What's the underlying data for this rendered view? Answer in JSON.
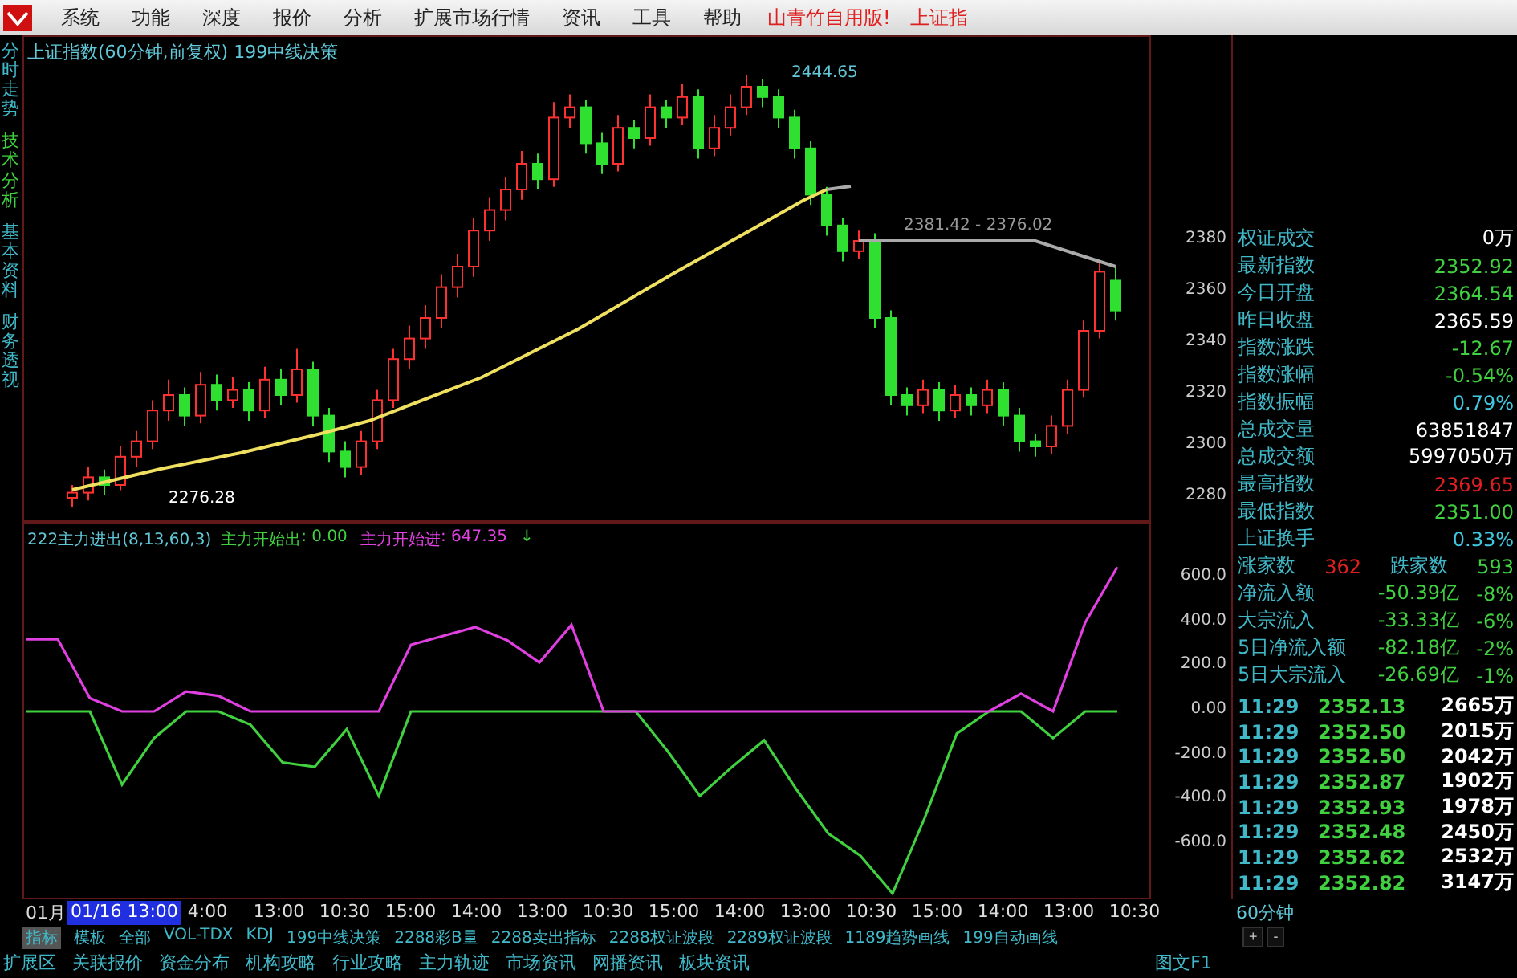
{
  "menu_bar": {
    "items": [
      "系统",
      "功能",
      "深度",
      "报价",
      "分析",
      "扩展市场行情",
      "资讯",
      "工具",
      "帮助"
    ],
    "notice": "山青竹自用版!",
    "notice_tail": "上证指"
  },
  "side_tabs": [
    {
      "label": "分时走势",
      "selected": false
    },
    {
      "label": "技术分析",
      "selected": true
    },
    {
      "label": "基本资料",
      "selected": false
    },
    {
      "label": "财务透视",
      "selected": false
    }
  ],
  "price_chart": {
    "title": "上证指数(60分钟,前复权) 199中线决策",
    "high_label": "2444.65",
    "low_label": "2276.28",
    "range_label": "2381.42 - 2376.02",
    "chart_data": {
      "type": "candlestick",
      "ylim": [
        2270.625,
        2460
      ],
      "yticks": [
        2380,
        2360,
        2340,
        2320,
        2300,
        2280
      ],
      "ohlc": [
        [
          2280,
          2285,
          2276.28,
          2282
        ],
        [
          2282,
          2292,
          2279,
          2288
        ],
        [
          2288,
          2291,
          2281,
          2285
        ],
        [
          2285,
          2300,
          2283,
          2296
        ],
        [
          2296,
          2306,
          2292,
          2302
        ],
        [
          2302,
          2318,
          2299,
          2314
        ],
        [
          2314,
          2326,
          2310,
          2320
        ],
        [
          2320,
          2323,
          2308,
          2312
        ],
        [
          2312,
          2329,
          2309,
          2324
        ],
        [
          2324,
          2328,
          2314,
          2318
        ],
        [
          2318,
          2327,
          2315,
          2322
        ],
        [
          2322,
          2325,
          2310,
          2314
        ],
        [
          2314,
          2331,
          2311,
          2326
        ],
        [
          2326,
          2330,
          2316,
          2320
        ],
        [
          2320,
          2338,
          2317,
          2330
        ],
        [
          2330,
          2333,
          2308,
          2312
        ],
        [
          2312,
          2315,
          2294,
          2298
        ],
        [
          2298,
          2302,
          2288,
          2292
        ],
        [
          2292,
          2306,
          2289,
          2302
        ],
        [
          2302,
          2322,
          2299,
          2318
        ],
        [
          2318,
          2338,
          2315,
          2334
        ],
        [
          2334,
          2347,
          2330,
          2342
        ],
        [
          2342,
          2355,
          2338,
          2350
        ],
        [
          2350,
          2367,
          2346,
          2362
        ],
        [
          2362,
          2375,
          2358,
          2370
        ],
        [
          2370,
          2389,
          2366,
          2384
        ],
        [
          2384,
          2397,
          2380,
          2392
        ],
        [
          2392,
          2405,
          2388,
          2400
        ],
        [
          2400,
          2415,
          2396,
          2410
        ],
        [
          2410,
          2414,
          2400,
          2404
        ],
        [
          2404,
          2434,
          2401,
          2428
        ],
        [
          2428,
          2437,
          2424,
          2432
        ],
        [
          2432,
          2435,
          2414,
          2418
        ],
        [
          2418,
          2422,
          2406,
          2410
        ],
        [
          2410,
          2429,
          2407,
          2424
        ],
        [
          2424,
          2427,
          2416,
          2420
        ],
        [
          2420,
          2437,
          2417,
          2432
        ],
        [
          2432,
          2435,
          2424,
          2428
        ],
        [
          2428,
          2441,
          2425,
          2436
        ],
        [
          2436,
          2439,
          2412,
          2416
        ],
        [
          2416,
          2429,
          2413,
          2424
        ],
        [
          2424,
          2437,
          2421,
          2432
        ],
        [
          2432,
          2444.65,
          2429,
          2440
        ],
        [
          2440,
          2443,
          2432,
          2436
        ],
        [
          2436,
          2439,
          2424,
          2428
        ],
        [
          2428,
          2431,
          2412,
          2416
        ],
        [
          2416,
          2419,
          2394,
          2398
        ],
        [
          2398,
          2401,
          2382,
          2386
        ],
        [
          2386,
          2389,
          2372,
          2376
        ],
        [
          2376,
          2384,
          2373,
          2380
        ],
        [
          2380,
          2383,
          2346,
          2350
        ],
        [
          2350,
          2353,
          2316,
          2320
        ],
        [
          2320,
          2323,
          2312,
          2316
        ],
        [
          2316,
          2326,
          2313,
          2322
        ],
        [
          2322,
          2325,
          2310,
          2314
        ],
        [
          2314,
          2324,
          2311,
          2320
        ],
        [
          2320,
          2323,
          2312,
          2316
        ],
        [
          2316,
          2326,
          2313,
          2322
        ],
        [
          2322,
          2325,
          2308,
          2312
        ],
        [
          2312,
          2315,
          2298,
          2302
        ],
        [
          2302,
          2305,
          2296,
          2300
        ],
        [
          2300,
          2312,
          2297,
          2308
        ],
        [
          2308,
          2326,
          2305,
          2322
        ],
        [
          2322,
          2349,
          2319,
          2345
        ],
        [
          2345,
          2372,
          2342,
          2368
        ],
        [
          2364.54,
          2369.65,
          2349,
          2352.92
        ]
      ]
    }
  },
  "indicator": {
    "title": "222主力进出(8,13,60,3)",
    "readings": [
      ": 0.00",
      ": 647.35"
    ],
    "arrow": "↓",
    "chart_data": {
      "type": "line",
      "ylim": [
        -846,
        853.2
      ],
      "yticks": [
        {
          "value": 600,
          "label": "600.0"
        },
        {
          "value": 400,
          "label": "400.0"
        },
        {
          "value": 200,
          "label": "200.0"
        },
        {
          "value": 0,
          "label": "0.00"
        },
        {
          "value": -200,
          "label": "-200.0"
        },
        {
          "value": -400,
          "label": "-400.0"
        },
        {
          "value": -600,
          "label": "-600.0"
        }
      ],
      "series": [
        {
          "name": "主力开始出",
          "color": "#40d040",
          "values": [
            0,
            0,
            0,
            -330,
            -120,
            0,
            0,
            -60,
            -230,
            -250,
            -80,
            -380,
            0,
            0,
            0,
            0,
            0,
            0,
            0,
            0,
            -180,
            -380,
            -250,
            -130,
            -350,
            -550,
            -650,
            -820,
            -480,
            -100,
            0,
            0,
            -120,
            0,
            0
          ]
        },
        {
          "name": "主力开始进",
          "color": "#e040e0",
          "values": [
            325,
            325,
            60,
            0,
            0,
            90,
            70,
            0,
            0,
            0,
            0,
            0,
            300,
            340,
            380,
            320,
            220,
            390,
            0,
            0,
            0,
            0,
            0,
            0,
            0,
            0,
            0,
            0,
            0,
            0,
            0,
            80,
            0,
            400,
            650
          ]
        }
      ]
    }
  },
  "info_panel": {
    "rows": [
      {
        "label": "权证成交",
        "value": "0万",
        "color": "#ffffff"
      },
      {
        "label": "最新指数",
        "value": "2352.92",
        "color": "#40d040"
      },
      {
        "label": "今日开盘",
        "value": "2364.54",
        "color": "#40d040"
      },
      {
        "label": "昨日收盘",
        "value": "2365.59",
        "color": "#ffffff"
      },
      {
        "label": "指数涨跌",
        "value": "-12.67",
        "color": "#40d040"
      },
      {
        "label": "指数涨幅",
        "value": "-0.54%",
        "color": "#40d040"
      },
      {
        "label": "指数振幅",
        "value": "0.79%",
        "color": "#40c8e0"
      },
      {
        "label": "总成交量",
        "value": "63851847",
        "color": "#ffffff"
      },
      {
        "label": "总成交额",
        "value": "5997050万",
        "color": "#ffffff"
      },
      {
        "label": "最高指数",
        "value": "2369.65",
        "color": "#e02020"
      },
      {
        "label": "最低指数",
        "value": "2351.00",
        "color": "#40d040"
      },
      {
        "label": "上证换手",
        "value": "0.33%",
        "color": "#40c8e0"
      }
    ],
    "breadth": {
      "up_label": "涨家数",
      "up_count": "362",
      "down_label": "跌家数",
      "down_count": "593"
    },
    "flows": [
      {
        "label": "净流入额",
        "amount": "-50.39亿",
        "pct": "-8%"
      },
      {
        "label": "大宗流入",
        "amount": "-33.33亿",
        "pct": "-6%"
      },
      {
        "label": "5日净流入额",
        "amount": "-82.18亿",
        "pct": "-2%"
      },
      {
        "label": "5日大宗流入",
        "amount": "-26.69亿",
        "pct": "-1%"
      }
    ],
    "ticks": [
      {
        "time": "11:29",
        "price": "2352.13",
        "volume": "2665万"
      },
      {
        "time": "11:29",
        "price": "2352.50",
        "volume": "2015万"
      },
      {
        "time": "11:29",
        "price": "2352.50",
        "volume": "2042万"
      },
      {
        "time": "11:29",
        "price": "2352.87",
        "volume": "1902万"
      },
      {
        "time": "11:29",
        "price": "2352.93",
        "volume": "1978万"
      },
      {
        "time": "11:29",
        "price": "2352.48",
        "volume": "2450万"
      },
      {
        "time": "11:29",
        "price": "2352.62",
        "volume": "2532万"
      },
      {
        "time": "11:29",
        "price": "2352.82",
        "volume": "3147万"
      }
    ]
  },
  "time_axis": {
    "first": "01月",
    "cursor": "01/16 13:00",
    "labels": [
      "4:00",
      "13:00",
      "10:30",
      "15:00",
      "14:00",
      "13:00",
      "10:30",
      "15:00",
      "14:00",
      "13:00",
      "10:30",
      "15:00",
      "14:00",
      "13:00",
      "10:30"
    ],
    "period": "60分钟"
  },
  "indicator_tabs": [
    {
      "label": "指标",
      "selected": true
    },
    {
      "label": "模板",
      "selected": false
    },
    {
      "label": "全部",
      "selected": false
    },
    {
      "label": "VOL-TDX",
      "selected": false
    },
    {
      "label": "KDJ",
      "selected": false
    },
    {
      "label": "199中线决策",
      "selected": false
    },
    {
      "label": "2288彩B量",
      "selected": false
    },
    {
      "label": "2288卖出指标",
      "selected": false
    },
    {
      "label": "2288权证波段",
      "selected": false
    },
    {
      "label": "2289权证波段",
      "selected": false
    },
    {
      "label": "1189趋势画线",
      "selected": false
    },
    {
      "label": "199自动画线",
      "selected": false
    }
  ],
  "zoom_buttons": [
    "+",
    "-"
  ],
  "bottom_tabs": [
    "扩展区",
    "关联报价",
    "资金分布",
    "机构攻略",
    "行业攻略",
    "主力轨迹",
    "市场资讯",
    "网播资讯",
    "板块资讯"
  ],
  "bottom_right": "图文F1"
}
